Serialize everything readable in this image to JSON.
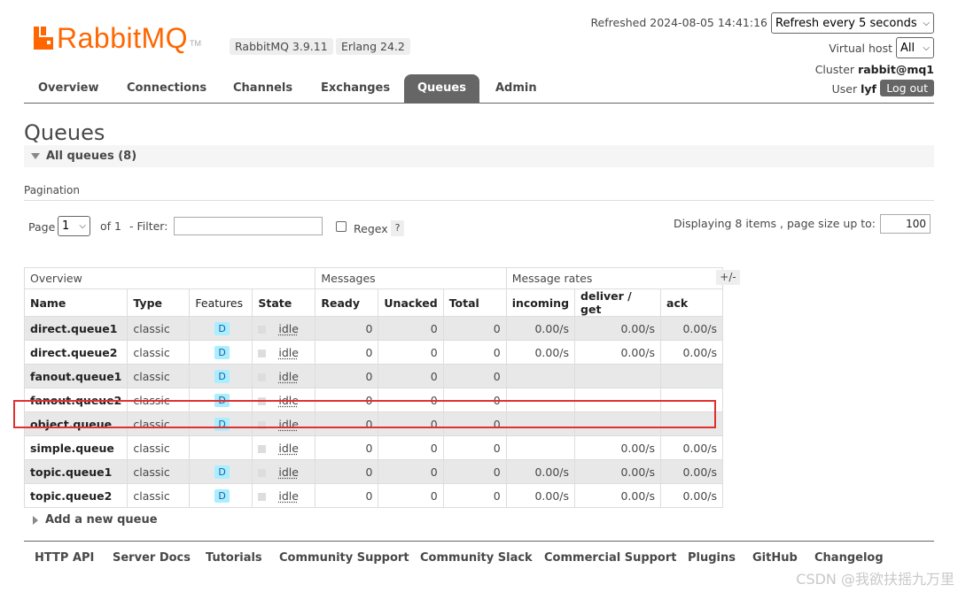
{
  "header": {
    "logo_text": "RabbitMQ",
    "logo_tm": "TM",
    "rabbitmq_version": "RabbitMQ 3.9.11",
    "erlang_version": "Erlang 24.2",
    "refreshed": "Refreshed 2024-08-05 14:41:16",
    "refresh_select": "Refresh every 5 seconds",
    "vhost_label": "Virtual host",
    "vhost_value": "All",
    "cluster_label": "Cluster",
    "cluster_value": "rabbit@mq1",
    "user_label": "User",
    "user_value": "lyf",
    "logout_label": "Log out"
  },
  "tabs": [
    "Overview",
    "Connections",
    "Channels",
    "Exchanges",
    "Queues",
    "Admin"
  ],
  "active_tab": "Queues",
  "page": {
    "title": "Queues",
    "section_label": "All queues (8)",
    "pagination_label": "Pagination",
    "page_label": "Page",
    "page_value": "1",
    "of_label": "of 1",
    "filter_label": "- Filter:",
    "filter_value": "",
    "regex_label": "Regex",
    "help_label": "?",
    "displaying": "Displaying 8 items , page size up to:",
    "page_size": "100",
    "plus_minus": "+/-",
    "add_queue": "Add a new queue"
  },
  "table": {
    "groups": [
      "Overview",
      "Messages",
      "Message rates"
    ],
    "columns": [
      "Name",
      "Type",
      "Features",
      "State",
      "Ready",
      "Unacked",
      "Total",
      "incoming",
      "deliver / get",
      "ack"
    ],
    "rows": [
      {
        "name": "direct.queue1",
        "type": "classic",
        "feature": "D",
        "state": "idle",
        "ready": "0",
        "unacked": "0",
        "total": "0",
        "incoming": "0.00/s",
        "deliver": "0.00/s",
        "ack": "0.00/s"
      },
      {
        "name": "direct.queue2",
        "type": "classic",
        "feature": "D",
        "state": "idle",
        "ready": "0",
        "unacked": "0",
        "total": "0",
        "incoming": "0.00/s",
        "deliver": "0.00/s",
        "ack": "0.00/s"
      },
      {
        "name": "fanout.queue1",
        "type": "classic",
        "feature": "D",
        "state": "idle",
        "ready": "0",
        "unacked": "0",
        "total": "0",
        "incoming": "",
        "deliver": "",
        "ack": ""
      },
      {
        "name": "fanout.queue2",
        "type": "classic",
        "feature": "D",
        "state": "idle",
        "ready": "0",
        "unacked": "0",
        "total": "0",
        "incoming": "",
        "deliver": "",
        "ack": ""
      },
      {
        "name": "object.queue",
        "type": "classic",
        "feature": "D",
        "state": "idle",
        "ready": "0",
        "unacked": "0",
        "total": "0",
        "incoming": "",
        "deliver": "",
        "ack": ""
      },
      {
        "name": "simple.queue",
        "type": "classic",
        "feature": "",
        "state": "idle",
        "ready": "0",
        "unacked": "0",
        "total": "0",
        "incoming": "",
        "deliver": "0.00/s",
        "ack": "0.00/s"
      },
      {
        "name": "topic.queue1",
        "type": "classic",
        "feature": "D",
        "state": "idle",
        "ready": "0",
        "unacked": "0",
        "total": "0",
        "incoming": "0.00/s",
        "deliver": "0.00/s",
        "ack": "0.00/s"
      },
      {
        "name": "topic.queue2",
        "type": "classic",
        "feature": "D",
        "state": "idle",
        "ready": "0",
        "unacked": "0",
        "total": "0",
        "incoming": "0.00/s",
        "deliver": "0.00/s",
        "ack": "0.00/s"
      }
    ]
  },
  "footer": [
    "HTTP API",
    "Server Docs",
    "Tutorials",
    "Community Support",
    "Community Slack",
    "Commercial Support",
    "Plugins",
    "GitHub",
    "Changelog"
  ],
  "watermark": "CSDN @我欲扶摇九万里",
  "colors": {
    "brand": "#ff6600",
    "tab_active": "#666666",
    "highlight": "#e03030",
    "feature_badge": "#aaeeff"
  }
}
